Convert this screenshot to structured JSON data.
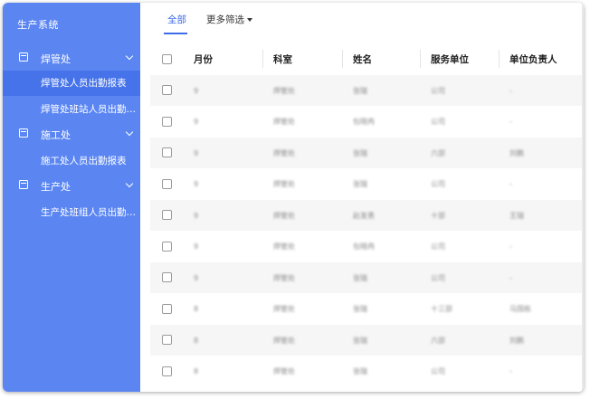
{
  "sidebar": {
    "brand": "生产系统",
    "groups": [
      {
        "label": "焊管处",
        "icon": "box-icon",
        "items": [
          "焊管处人员出勤报表",
          "焊管处班站人员出勤报表"
        ]
      },
      {
        "label": "施工处",
        "icon": "box-icon",
        "items": [
          "施工处人员出勤报表"
        ]
      },
      {
        "label": "生产处",
        "icon": "box-icon",
        "items": [
          "生产处班组人员出勤报表"
        ]
      }
    ],
    "active_item": "焊管处人员出勤报表"
  },
  "tabs": {
    "all": "全部",
    "more_filters": "更多筛选"
  },
  "table": {
    "headers": [
      "月份",
      "科室",
      "姓名",
      "服务单位",
      "单位负责人"
    ],
    "rows": [
      [
        "9",
        "焊管处",
        "张瑞",
        "公司",
        "-"
      ],
      [
        "9",
        "焊管处",
        "包晓冉",
        "公司",
        "-"
      ],
      [
        "9",
        "焊管处",
        "张瑞",
        "六部",
        "刘鹏"
      ],
      [
        "9",
        "焊管处",
        "张瑞",
        "公司",
        "-"
      ],
      [
        "9",
        "焊管处",
        "赵发勇",
        "十部",
        "王瑞"
      ],
      [
        "9",
        "焊管处",
        "包晓冉",
        "公司",
        "-"
      ],
      [
        "9",
        "焊管处",
        "张瑞",
        "公司",
        "-"
      ],
      [
        "8",
        "焊管处",
        "张瑞",
        "十三部",
        "马国栋"
      ],
      [
        "8",
        "焊管处",
        "张瑞",
        "六部",
        "刘鹏"
      ],
      [
        "8",
        "焊管处",
        "张瑞",
        "公司",
        "-"
      ]
    ]
  },
  "colors": {
    "sidebar_bg": "#5b86f2",
    "sidebar_active": "#4673ea",
    "accent": "#3e6ce8",
    "stripe": "#f6f6f6"
  }
}
